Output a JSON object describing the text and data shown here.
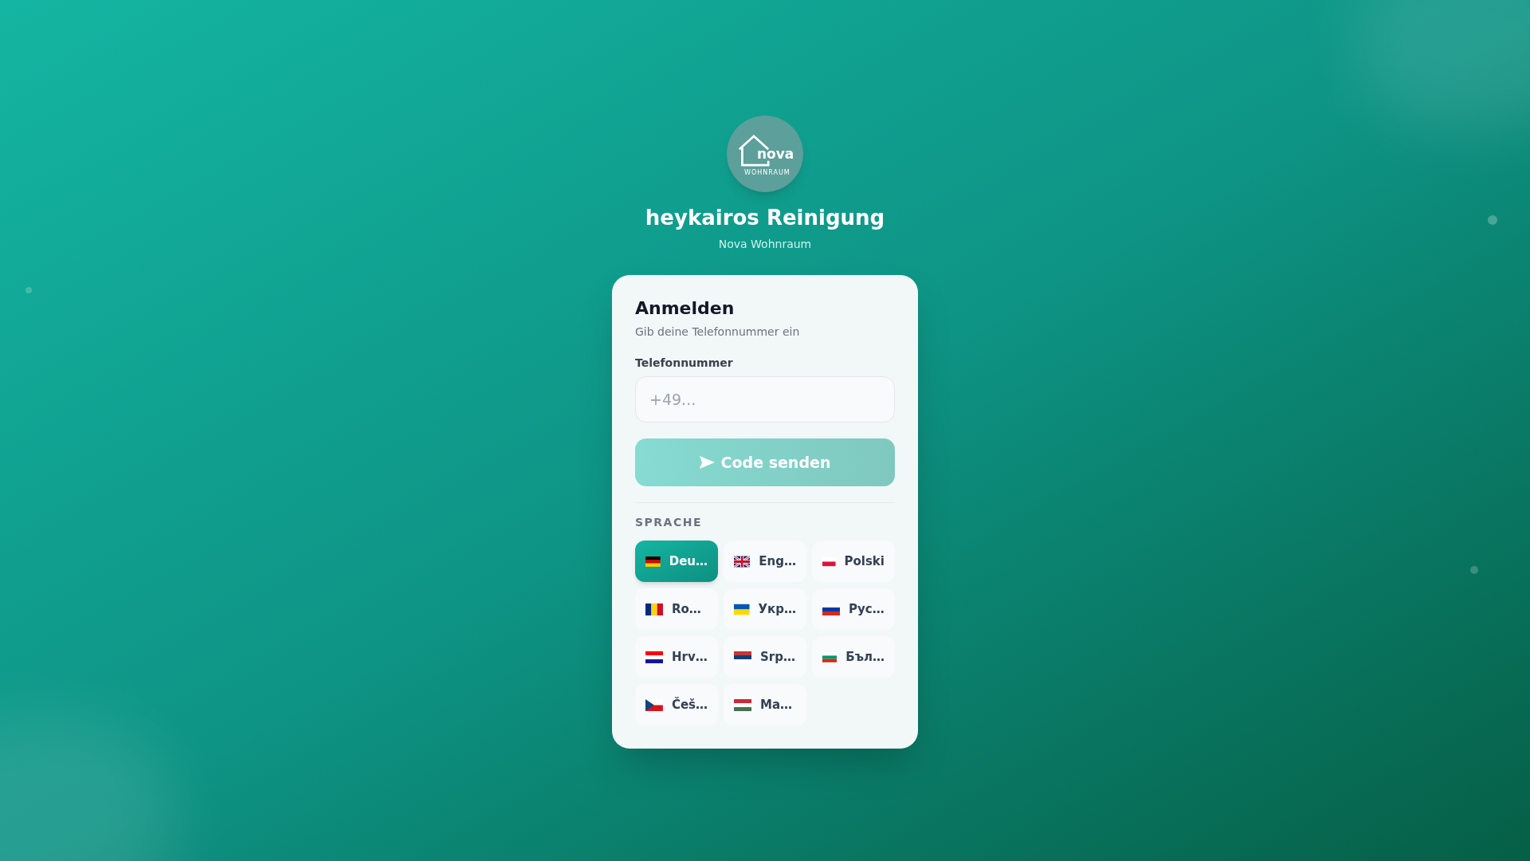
{
  "logo": {
    "wordmark": "nova",
    "tagline": "WOHNRAUM"
  },
  "title": "heykairos Reinigung",
  "subtitle": "Nova Wohnraum",
  "card": {
    "heading": "Anmelden",
    "description": "Gib deine Telefonnummer ein",
    "phone_field": {
      "label": "Telefonnummer",
      "placeholder": "+49..."
    },
    "submit_button": {
      "label": "Code senden",
      "disabled": true
    },
    "language_section": {
      "heading": "SPRACHE",
      "languages": [
        {
          "label": "Deu…",
          "kind": "german",
          "selected": true
        },
        {
          "label": "Eng…",
          "kind": "british",
          "selected": false
        },
        {
          "label": "Polski",
          "kind": "polish",
          "selected": false
        },
        {
          "label": "Ro…",
          "kind": "romanian",
          "selected": false
        },
        {
          "label": "Укр…",
          "kind": "ukrainian",
          "selected": false
        },
        {
          "label": "Рус…",
          "kind": "russian",
          "selected": false
        },
        {
          "label": "Hrv…",
          "kind": "croatian",
          "selected": false
        },
        {
          "label": "Srp…",
          "kind": "serbian",
          "selected": false
        },
        {
          "label": "Бъл…",
          "kind": "bulgarian",
          "selected": false
        },
        {
          "label": "Češ…",
          "kind": "czech",
          "selected": false
        },
        {
          "label": "Ma…",
          "kind": "hungarian",
          "selected": false
        }
      ]
    }
  }
}
